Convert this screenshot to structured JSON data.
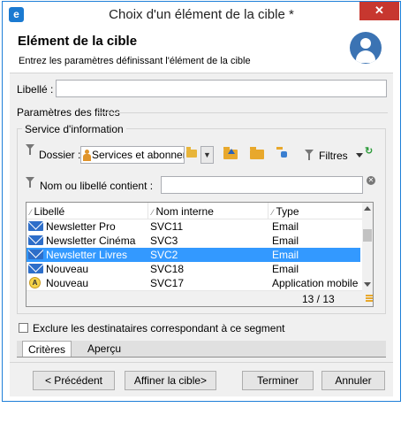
{
  "window": {
    "title": "Choix d'un élément de la cible *",
    "close_label": "✕"
  },
  "header": {
    "title": "Elément de la cible",
    "subtitle": "Entrez les paramètres définissant l'élément de la cible"
  },
  "form": {
    "libelle_label": "Libellé :",
    "libelle_value": "",
    "filters_section": "Paramètres des filtres",
    "service_group": "Service d'information",
    "dossier_label": "Dossier :",
    "dossier_value": "Services et abonner",
    "filtres_label": "Filtres",
    "search_label": "Nom ou libellé contient :",
    "search_value": ""
  },
  "table": {
    "columns": [
      "Libellé",
      "Nom interne",
      "Type"
    ],
    "rows": [
      {
        "label": "Newsletter Pro",
        "internal": "SVC11",
        "type": "Email",
        "icon": "mail-icon"
      },
      {
        "label": "Newsletter Cinéma",
        "internal": "SVC3",
        "type": "Email",
        "icon": "mail-icon"
      },
      {
        "label": "Newsletter Livres",
        "internal": "SVC2",
        "type": "Email",
        "icon": "mail-icon",
        "selected": true
      },
      {
        "label": "Nouveau",
        "internal": "SVC18",
        "type": "Email",
        "icon": "mail-icon"
      },
      {
        "label": "Nouveau",
        "internal": "SVC17",
        "type": "Application mobile",
        "icon": "mobile-app-icon"
      }
    ],
    "page_count": "13 / 13"
  },
  "exclude": {
    "label": "Exclure les destinataires correspondant à ce segment",
    "checked": false
  },
  "tabs": [
    "Critères",
    "Aperçu"
  ],
  "buttons": {
    "previous": "< Précédent",
    "refine": "Affiner la cible>",
    "finish": "Terminer",
    "cancel": "Annuler"
  },
  "colors": {
    "selection": "#3399ff",
    "accent": "#1e7fd8",
    "close": "#c7372f"
  }
}
